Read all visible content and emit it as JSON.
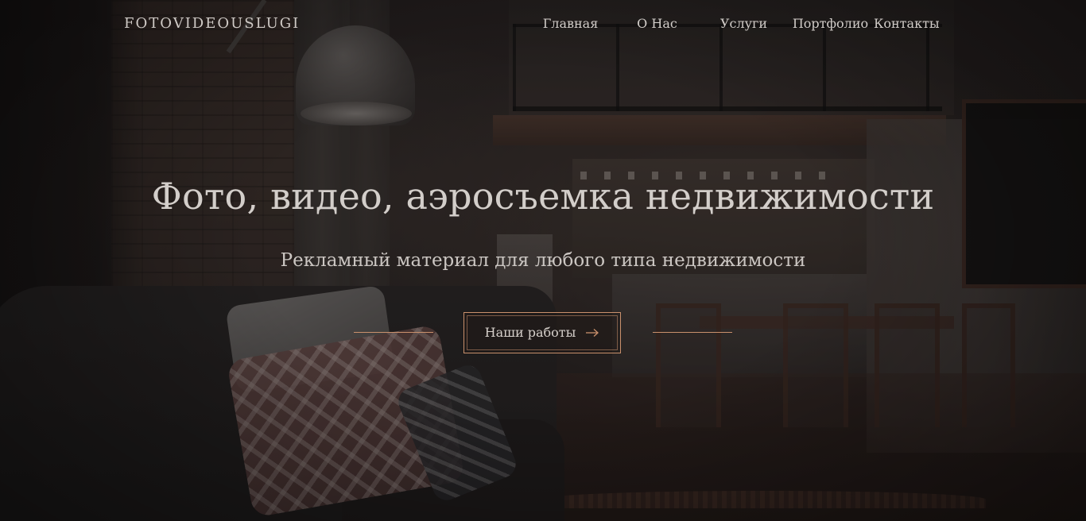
{
  "header": {
    "logo": "FOTOVIDEOUSLUGI",
    "nav": [
      {
        "label": "Главная"
      },
      {
        "label": "О Нас"
      },
      {
        "label": "Услуги"
      },
      {
        "label": "Портфолио"
      },
      {
        "label": "Контакты"
      }
    ]
  },
  "hero": {
    "title": "Фото, видео, аэросъемка недвижимости",
    "subtitle": "Рекламный материал для любого типа недвижимости",
    "cta": {
      "label": "Наши работы",
      "icon": "arrow-right-icon"
    }
  },
  "colors": {
    "accent": "#c9906c",
    "text": "#d3ceca",
    "overlay": "#1a1717"
  }
}
